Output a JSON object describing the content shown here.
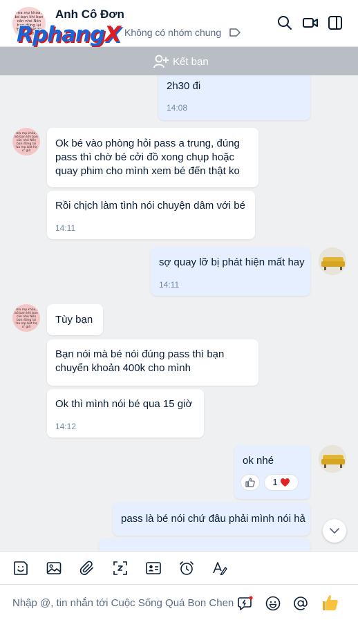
{
  "header": {
    "name": "Anh Cô Đơn",
    "subtitle": "Không có nhóm chung",
    "avatar_text": "ma mp khóa, bỏ bạn khi bạn cần nhé Nên bạn đừng lại 'ba mp bắt hẹ ư' giờ",
    "watermark": "Rphang",
    "watermark_x": "X"
  },
  "friend_bar": {
    "label": "Kết bạn"
  },
  "messages": [
    {
      "text": "2h30 đi",
      "time": "14:08"
    },
    {
      "text": "Ok bé vào phòng hỏi pass a trung, đúng\npass thì chờ bé cởi đồ xong chụp hoặc\nquay phim cho mình xem bé đến thật ko"
    },
    {
      "text": "Rồi chịch làm tình nói chuyện dâm với bé",
      "time": "14:11"
    },
    {
      "text": "sợ quay lỡ bị phát hiện mất hay",
      "time": "14:11"
    },
    {
      "text": "Tùy bạn"
    },
    {
      "text": "Bạn nói mà bé nói đúng pass thì bạn\nchuyển khoản 400k cho mình"
    },
    {
      "text": "Ok thì mình nói bé qua 15 giờ",
      "time": "14:12"
    },
    {
      "text": "ok nhé",
      "reaction_count": "1"
    },
    {
      "text": "pass là bé nói chứ đâu phải mình nói hả"
    }
  ],
  "input": {
    "placeholder": "Nhập @, tin nhắn tới Cuộc Sống Quá Bon Chen"
  },
  "colors": {
    "out_bubble": "#e5efff",
    "in_bubble": "#ffffff",
    "accent": "#0068ff",
    "heart": "#e02424"
  }
}
